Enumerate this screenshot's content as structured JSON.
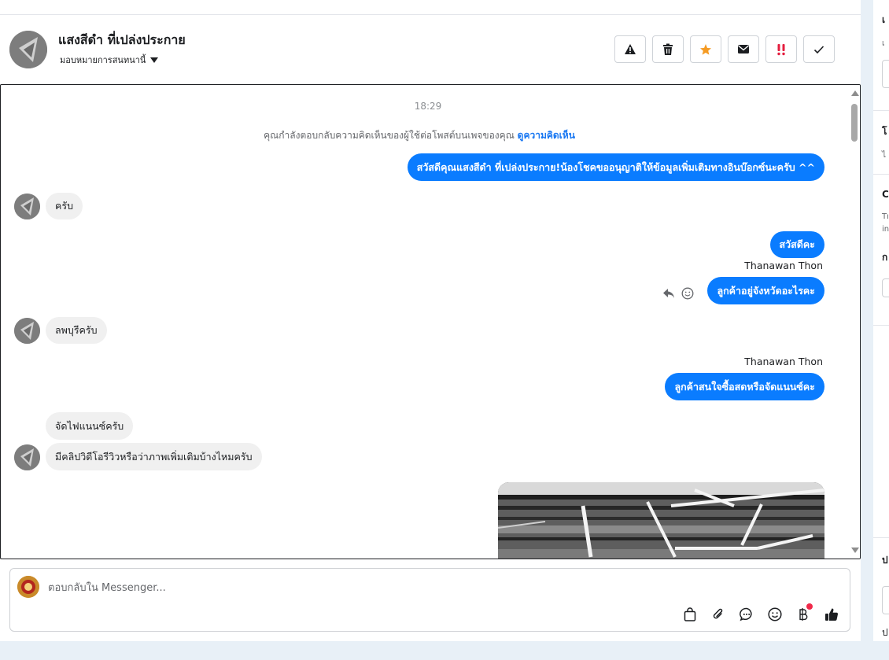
{
  "header": {
    "contact_name": "แสงสีดำ ที่เปล่งประกาย",
    "assign_label": "มอบหมายการสนทนานี้"
  },
  "actions": [
    {
      "name": "spam-button",
      "icon": "warning-icon"
    },
    {
      "name": "delete-button",
      "icon": "trash-icon"
    },
    {
      "name": "star-button",
      "icon": "star-icon",
      "color": "#f59b23"
    },
    {
      "name": "mark-unread-button",
      "icon": "envelope-icon"
    },
    {
      "name": "follow-up-button",
      "icon": "double-exclamation-icon",
      "color": "#e41e3f"
    },
    {
      "name": "done-button",
      "icon": "check-icon"
    }
  ],
  "chat": {
    "timestamp": "18:29",
    "notice_text": "คุณกำลังตอบกลับความคิดเห็นของผู้ใช้ต่อโพสต์บนเพจของคุณ",
    "notice_link": "ดูความคิดเห็น",
    "messages": [
      {
        "dir": "out",
        "text": "สวัสดีคุณแสงสีดำ ที่เปล่งประกาย!น้องโชคขออนุญาติให้ข้อมูลเพิ่มเติมทางอินบ๊อกซ์นะครับ ^^"
      },
      {
        "dir": "in",
        "text": "ครับ"
      },
      {
        "dir": "out",
        "text": "สวัสดีคะ"
      },
      {
        "dir": "out",
        "sender": "Thanawan Thon",
        "text": "ลูกค้าอยู่จังหวัดอะไรคะ"
      },
      {
        "dir": "in",
        "text": "ลพบุรีครับ"
      },
      {
        "dir": "out",
        "sender": "Thanawan Thon",
        "text": "ลูกค้าสนใจซื้อสดหรือจัดแนนซ์คะ"
      },
      {
        "dir": "in",
        "text": "จัดไฟแนนซ์ครับ"
      },
      {
        "dir": "in",
        "text": "มีคลิปวิดีโอรีวิวหรือว่าภาพเพิ่มเติมบ้างไหมครับ"
      }
    ]
  },
  "composer": {
    "placeholder": "ตอบกลับใน Messenger..."
  },
  "colors": {
    "outgoing_bubble": "#0a7cff",
    "incoming_bubble": "#f0f0f0",
    "link": "#1877f2"
  }
}
